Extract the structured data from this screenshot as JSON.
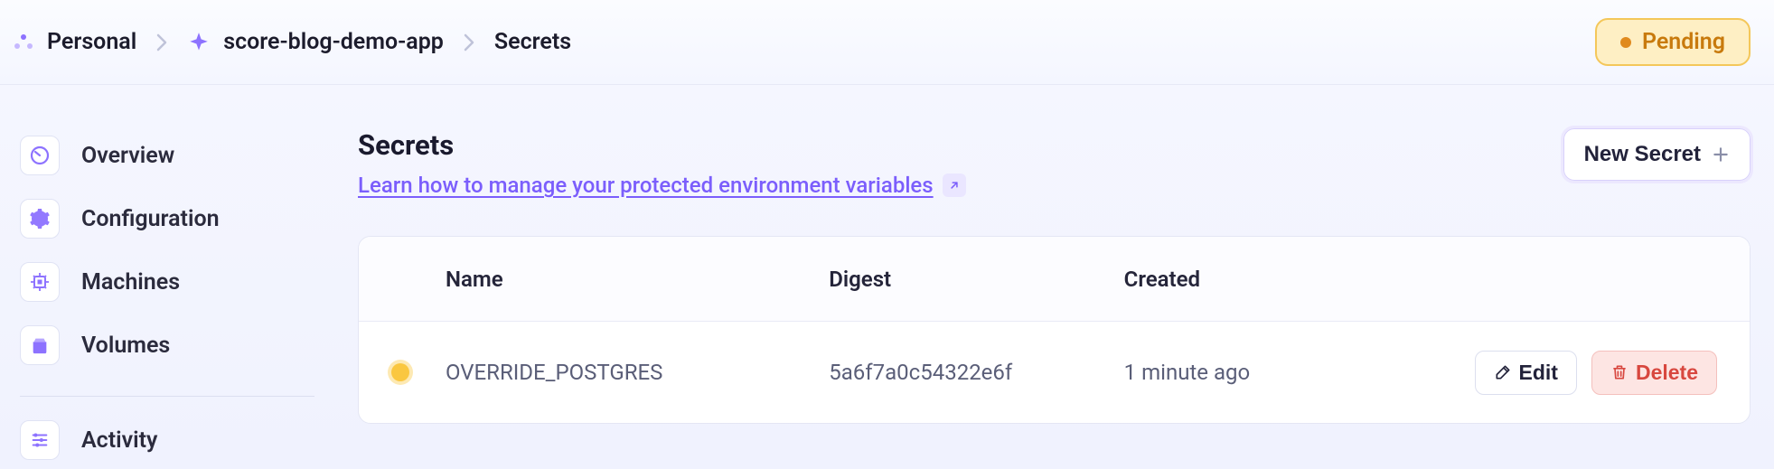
{
  "breadcrumb": {
    "org": "Personal",
    "app": "score-blog-demo-app",
    "section": "Secrets"
  },
  "status": {
    "label": "Pending"
  },
  "sidebar": {
    "items": [
      {
        "label": "Overview"
      },
      {
        "label": "Configuration"
      },
      {
        "label": "Machines"
      },
      {
        "label": "Volumes"
      },
      {
        "label": "Activity"
      }
    ]
  },
  "main": {
    "title": "Secrets",
    "help_link": "Learn how to manage your protected environment variables",
    "new_button": "New Secret"
  },
  "table": {
    "headers": {
      "name": "Name",
      "digest": "Digest",
      "created": "Created"
    },
    "rows": [
      {
        "name": "OVERRIDE_POSTGRES",
        "digest": "5a6f7a0c54322e6f",
        "created": "1 minute ago"
      }
    ],
    "actions": {
      "edit": "Edit",
      "delete": "Delete"
    }
  }
}
